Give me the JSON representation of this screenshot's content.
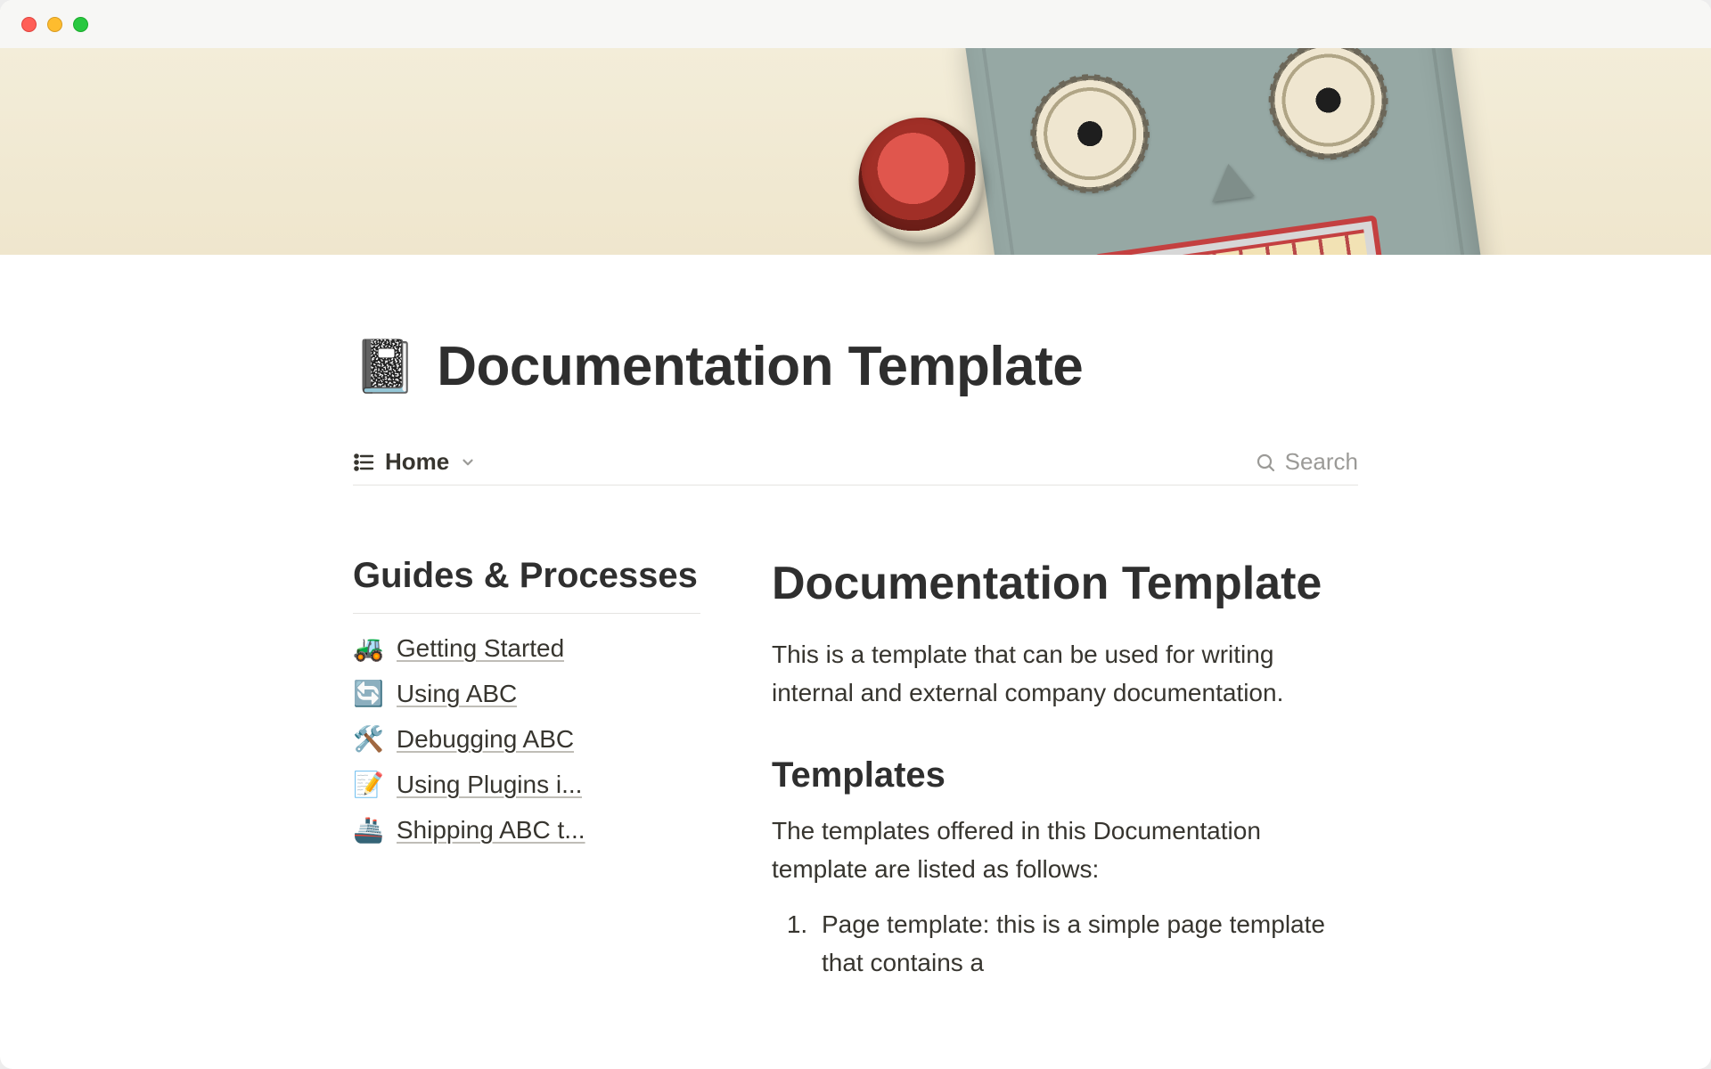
{
  "page": {
    "icon": "📓",
    "title": "Documentation Template"
  },
  "db": {
    "view_name": "Home",
    "search_label": "Search"
  },
  "sidebar": {
    "title": "Guides & Processes",
    "items": [
      {
        "emoji": "🚜",
        "label": "Getting Started"
      },
      {
        "emoji": "🔄",
        "label": "Using ABC"
      },
      {
        "emoji": "🛠️",
        "label": "Debugging ABC"
      },
      {
        "emoji": "📝",
        "label": "Using Plugins i..."
      },
      {
        "emoji": "🚢",
        "label": "Shipping ABC t..."
      }
    ]
  },
  "content": {
    "heading": "Documentation Template",
    "intro": "This is a template that can be used for writing internal and external company documentation.",
    "section_heading": "Templates",
    "section_intro": "The templates offered in this Documentation template are listed as follows:",
    "list": {
      "item1": "Page template: this is a simple page template that contains a"
    }
  }
}
